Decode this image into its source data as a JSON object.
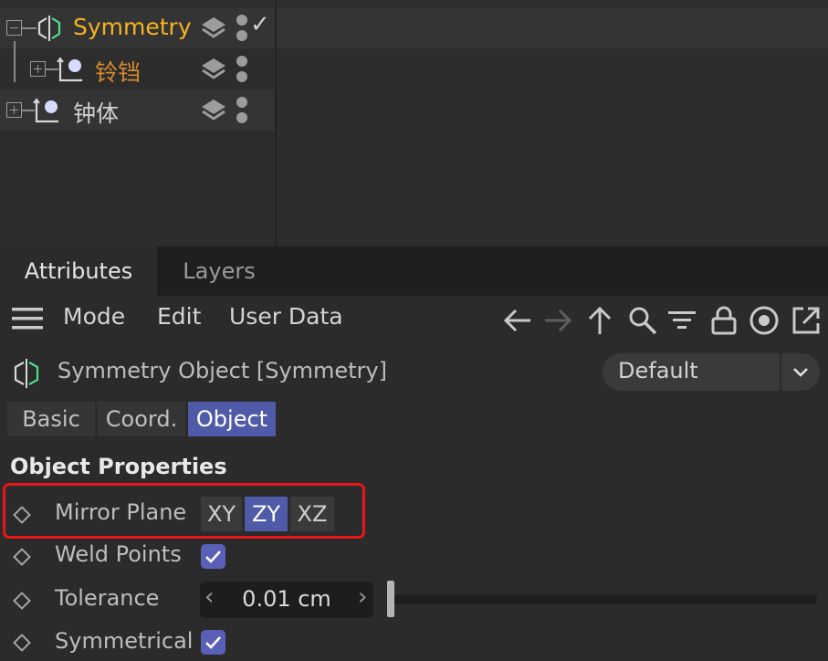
{
  "object_manager": {
    "rows": [
      {
        "name": "Symmetry",
        "color": "#f5b223",
        "expander": "minus",
        "icon": "symmetry-icon",
        "checked": true
      },
      {
        "name": "铃铛",
        "color": "#d98a2c",
        "expander": "plus",
        "icon": "null-object-icon",
        "checked": false
      },
      {
        "name": "钟体",
        "color": "#d0d0d0",
        "expander": "plus",
        "icon": "null-object-icon",
        "checked": false
      }
    ],
    "check_mark": "✓"
  },
  "tabs": [
    {
      "label": "Attributes",
      "active": true
    },
    {
      "label": "Layers",
      "active": false
    }
  ],
  "menu": {
    "items": [
      "Mode",
      "Edit",
      "User Data"
    ],
    "tool_icons": [
      "arrow-left-icon",
      "arrow-right-icon",
      "arrow-up-icon",
      "search-icon",
      "filter-icon",
      "lock-icon",
      "target-icon",
      "new-window-icon"
    ]
  },
  "object": {
    "title": "Symmetry Object [Symmetry]",
    "icon": "symmetry-icon",
    "preset": "Default"
  },
  "subtabs": [
    {
      "label": "Basic",
      "active": false
    },
    {
      "label": "Coord.",
      "active": false
    },
    {
      "label": "Object",
      "active": true
    }
  ],
  "section_title": "Object Properties",
  "properties": {
    "mirror_plane": {
      "label": "Mirror Plane",
      "options": [
        "XY",
        "ZY",
        "XZ"
      ],
      "selected": "ZY"
    },
    "weld_points": {
      "label": "Weld Points",
      "checked": true
    },
    "tolerance": {
      "label": "Tolerance",
      "value": "0.01 cm",
      "left_arrow": "‹",
      "right_arrow": "›",
      "slider_fraction": 0.0
    },
    "symmetrical": {
      "label": "Symmetrical",
      "checked": true
    }
  },
  "colors": {
    "accent": "#4f5aa8",
    "checkbox": "#5a5fb8",
    "highlight_box": "#e8151b",
    "symmetry_icon": "#4fe08a"
  }
}
